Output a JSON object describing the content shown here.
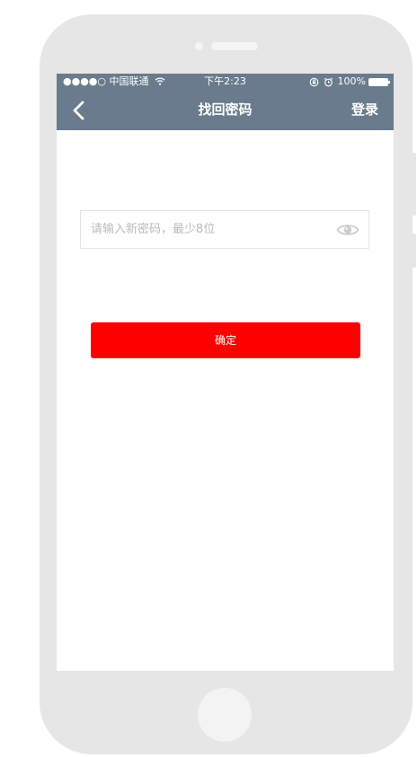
{
  "status_bar": {
    "carrier": "●●●●○ 中国联通",
    "time": "下午2:23",
    "battery_percent": "100%"
  },
  "nav": {
    "title": "找回密码",
    "right_label": "登录"
  },
  "form": {
    "password_placeholder": "请输入新密码，最少8位",
    "password_value": ""
  },
  "actions": {
    "confirm_label": "确定"
  },
  "colors": {
    "nav_bg": "#697b8c",
    "confirm_bg": "#ff0000",
    "phone_body": "#e6e6e6"
  },
  "icons": {
    "back": "chevron-left-icon",
    "visibility": "eye-icon",
    "wifi": "wifi-icon",
    "lock_rotation": "rotation-lock-icon",
    "alarm": "alarm-icon",
    "battery": "battery-icon"
  }
}
